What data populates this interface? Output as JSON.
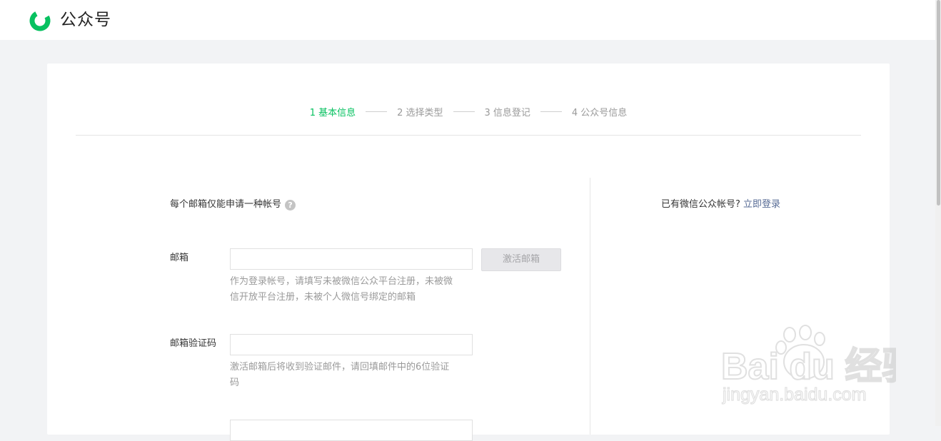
{
  "header": {
    "brand": "公众号"
  },
  "steps": [
    {
      "label": "1 基本信息",
      "active": true
    },
    {
      "label": "2 选择类型",
      "active": false
    },
    {
      "label": "3 信息登记",
      "active": false
    },
    {
      "label": "4 公众号信息",
      "active": false
    }
  ],
  "form": {
    "notice": "每个邮箱仅能申请一种帐号",
    "help_icon_glyph": "?",
    "email": {
      "label": "邮箱",
      "value": "",
      "activate_button": "激活邮箱",
      "hint": "作为登录帐号，请填写未被微信公众平台注册，未被微信开放平台注册，未被个人微信号绑定的邮箱"
    },
    "email_code": {
      "label": "邮箱验证码",
      "value": "",
      "hint": "激活邮箱后将收到验证邮件，请回填邮件中的6位验证码"
    }
  },
  "aside": {
    "question": "已有微信公众帐号?",
    "login_link": "立即登录"
  },
  "watermark": {
    "brand": "Bai du 经验",
    "url": "jingyan.baidu.com"
  },
  "colors": {
    "accent": "#07c160",
    "link": "#576b95",
    "muted": "#9a9a9a"
  },
  "icons": [
    "wechat-official-account-logo-icon",
    "help-circle-icon",
    "baidu-paw-icon"
  ]
}
